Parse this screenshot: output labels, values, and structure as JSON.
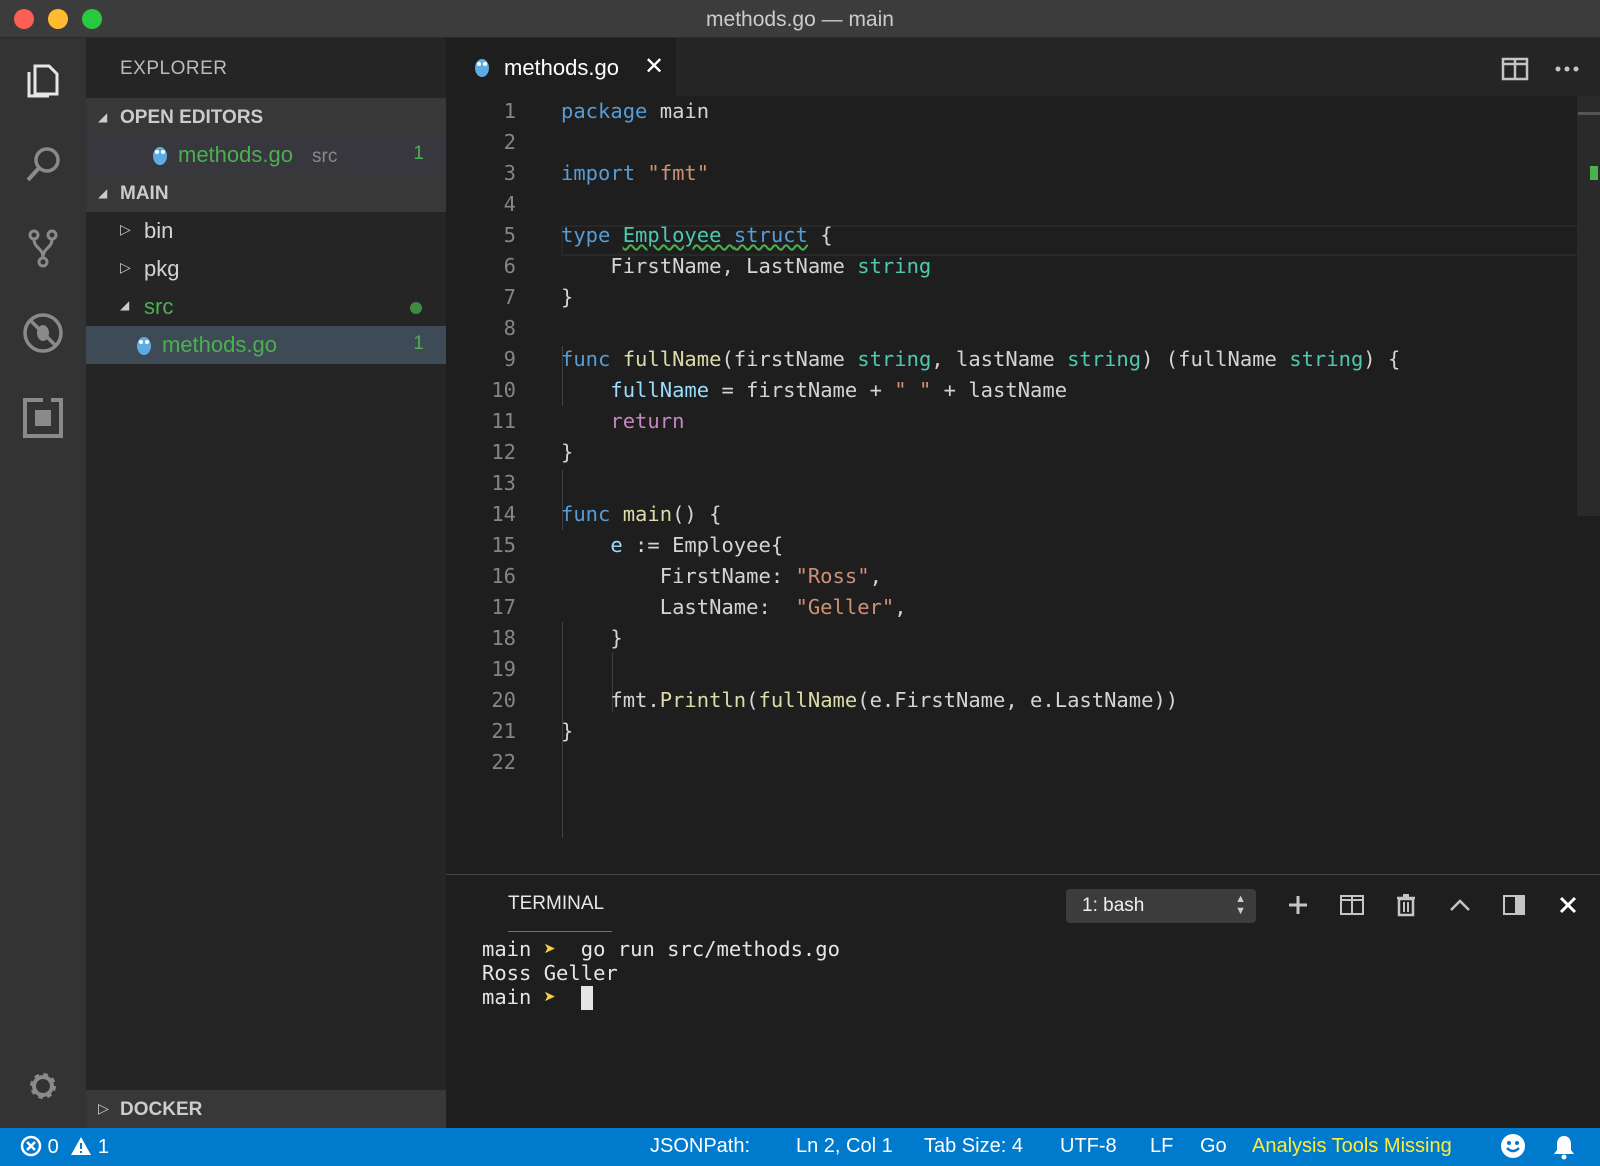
{
  "window": {
    "title": "methods.go — main"
  },
  "activity_bar": {
    "items": [
      "files-icon",
      "search-icon",
      "source-control-icon",
      "debug-icon",
      "extensions-icon"
    ],
    "bottom": "gear-icon"
  },
  "sidebar": {
    "title": "EXPLORER",
    "open_editors": {
      "label": "OPEN EDITORS",
      "items": [
        {
          "name": "methods.go",
          "dir": "src",
          "problems": "1"
        }
      ]
    },
    "main": {
      "label": "MAIN",
      "folders": [
        {
          "name": "bin"
        },
        {
          "name": "pkg"
        },
        {
          "name": "src"
        }
      ],
      "file": {
        "name": "methods.go",
        "problems": "1"
      }
    },
    "docker": {
      "label": "DOCKER"
    }
  },
  "editor": {
    "tab": {
      "label": "methods.go",
      "close": "✕"
    },
    "line_numbers": [
      "1",
      "2",
      "3",
      "4",
      "5",
      "6",
      "7",
      "8",
      "9",
      "10",
      "11",
      "12",
      "13",
      "14",
      "15",
      "16",
      "17",
      "18",
      "19",
      "20",
      "21",
      "22"
    ],
    "code": {
      "l1": [
        "package",
        " main"
      ],
      "l3": [
        "import",
        " ",
        "\"fmt\""
      ],
      "l5": [
        "type",
        " ",
        "Employee",
        " ",
        "struct",
        " {"
      ],
      "l6": [
        "    FirstName, LastName ",
        "string"
      ],
      "l7": "}",
      "l9": [
        "func",
        " ",
        "fullName",
        "(firstName ",
        "string",
        ", lastName ",
        "string",
        ") (fullName ",
        "string",
        ") {"
      ],
      "l10": [
        "    ",
        "fullName",
        " = firstName + ",
        "\" \"",
        " + lastName"
      ],
      "l11": [
        "    ",
        "return"
      ],
      "l12": "}",
      "l14": [
        "func",
        " ",
        "main",
        "() {"
      ],
      "l15": [
        "    ",
        "e",
        " := Employee{"
      ],
      "l16": [
        "        FirstName: ",
        "\"Ross\"",
        ","
      ],
      "l17": [
        "        LastName:  ",
        "\"Geller\"",
        ","
      ],
      "l18": "    }",
      "l20": [
        "    fmt.",
        "Println",
        "(",
        "fullName",
        "(e.FirstName, e.LastName))"
      ],
      "l21": "}"
    }
  },
  "terminal": {
    "tab": "TERMINAL",
    "shell_select": "1: bash",
    "lines": [
      {
        "cwd": "main",
        "arrow": "➤",
        "cmd": " go run src/methods.go"
      },
      {
        "output": "Ross Geller"
      },
      {
        "cwd": "main",
        "arrow": "➤",
        "cmd": ""
      }
    ]
  },
  "status_bar": {
    "errors": "0",
    "warnings": "1",
    "jsonpath": "JSONPath:",
    "cursor": "Ln 2, Col 1",
    "tab_size": "Tab Size: 4",
    "encoding": "UTF-8",
    "eol": "LF",
    "language": "Go",
    "analysis": "Analysis Tools Missing"
  },
  "colors": {
    "status_bar": "#007acc",
    "accent_green": "#4caf50",
    "warning_yellow": "#ffeb3b",
    "keyword": "#569cd6",
    "type": "#4ec9b0",
    "string": "#ce9178"
  }
}
